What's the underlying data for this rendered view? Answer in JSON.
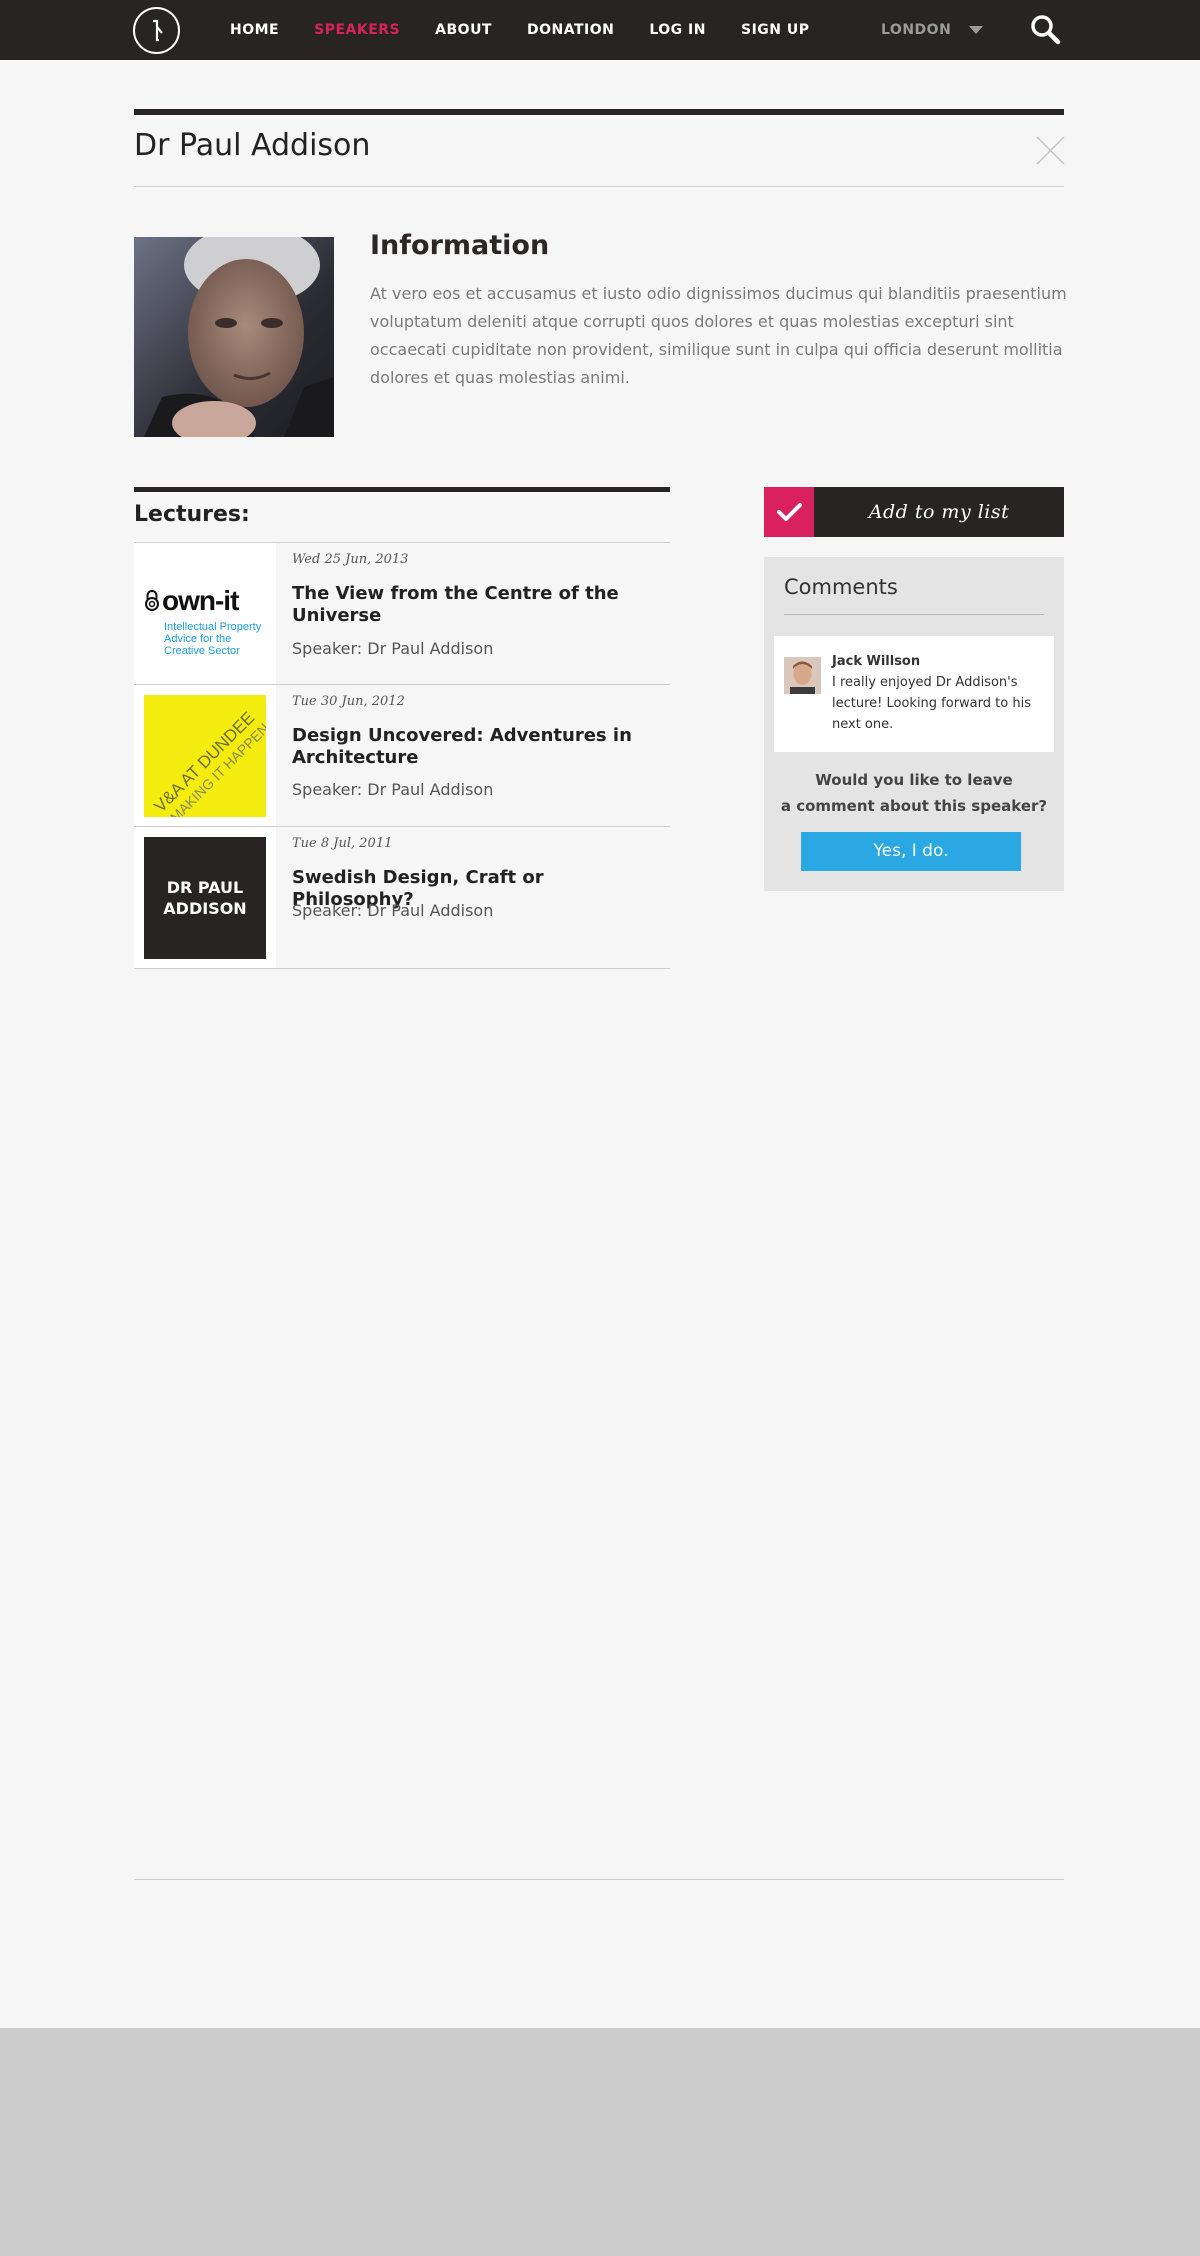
{
  "nav": {
    "items": [
      "HOME",
      "SPEAKERS",
      "ABOUT",
      "DONATION",
      "LOG IN",
      "SIGN UP"
    ],
    "active": "SPEAKERS",
    "city": "LONDON"
  },
  "speaker": {
    "name": "Dr Paul Addison",
    "info_heading": "Information",
    "info_text": "At vero eos et accusamus et iusto odio dignissimos ducimus qui blanditiis praesentium voluptatum deleniti atque corrupti quos dolores et quas molestias excepturi sint occaecati cupiditate non provident, similique sunt in culpa qui officia deserunt mollitia dolores et quas molestias animi."
  },
  "lectures": {
    "heading": "Lectures:",
    "items": [
      {
        "date": "Wed 25 Jun, 2013",
        "title": "The View from the Centre of the Universe",
        "speaker": "Speaker: Dr Paul Addison",
        "thumb": {
          "brand": "own-it",
          "tagline": "Intellectual Property Advice for the Creative Sector"
        }
      },
      {
        "date": "Tue 30 Jun, 2012",
        "title": "Design Uncovered: Adventures in Architecture",
        "speaker": "Speaker: Dr Paul Addison",
        "thumb": {
          "line1": "V&A AT DUNDEE",
          "line2": "MAKING IT HAPPEN"
        }
      },
      {
        "date": "Tue 8 Jul, 2011",
        "title": "Swedish Design, Craft or Philosophy?",
        "speaker": "Speaker: Dr Paul Addison",
        "thumb": {
          "text": "DR PAUL\nADDISON"
        }
      }
    ]
  },
  "sidebar": {
    "add_label": "Add to my list",
    "comments_heading": "Comments",
    "comment": {
      "author": "Jack Willson",
      "text": "I really enjoyed Dr Addison's lecture!  Looking forward to his next one."
    },
    "leave_question": "Would you like to leave\na comment about this speaker?",
    "yes_label": "Yes, I do."
  },
  "colors": {
    "topbar": "#282424",
    "accent": "#d9215f",
    "button_blue": "#29a8e3",
    "background": "#f6f6f6",
    "footer": "#cdcdcd"
  }
}
